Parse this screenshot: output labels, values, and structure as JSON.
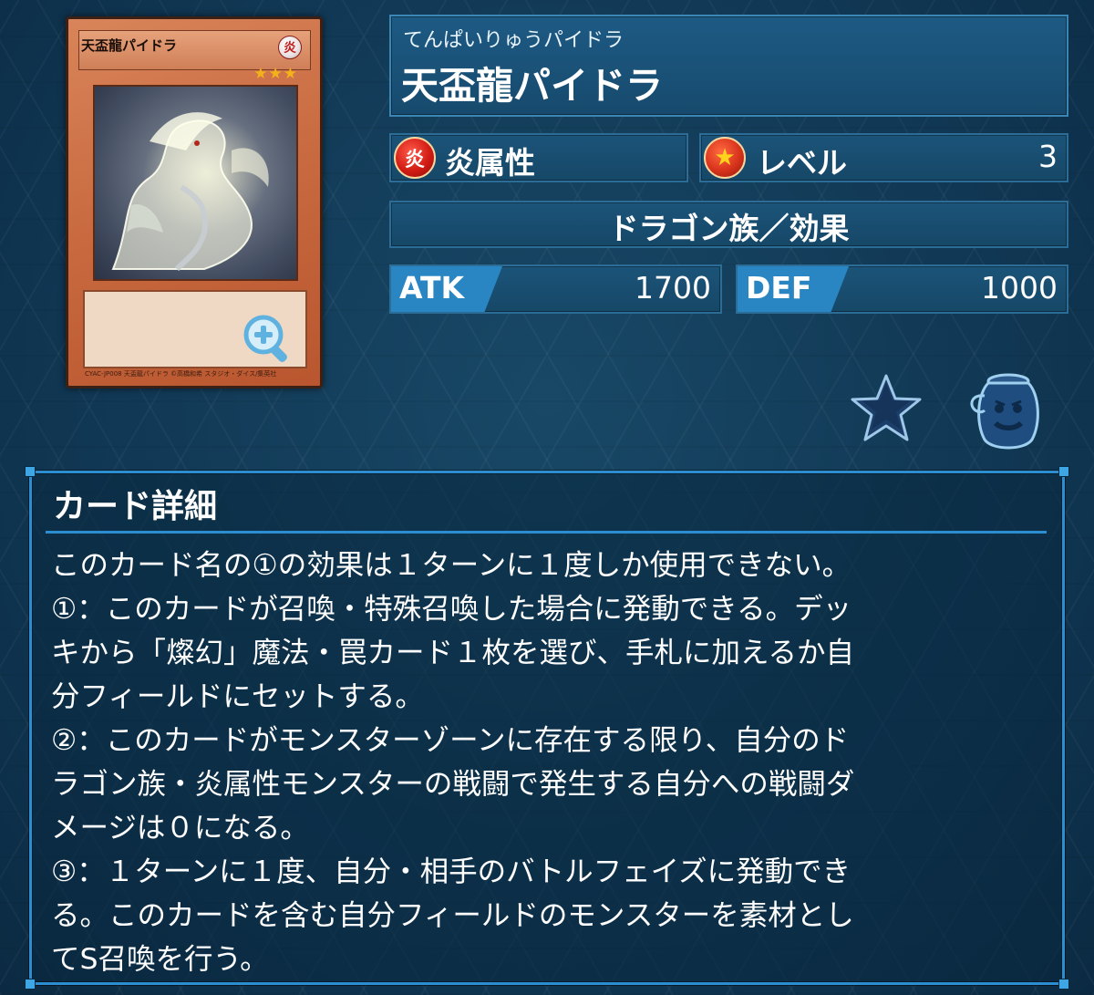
{
  "card_image": {
    "name_text": "天盃龍パイドラ",
    "attribute_glyph": "炎",
    "stars": "★★★",
    "footer_text": "CYAC-JP008 天盃龍パイドラ ©高橋和希 スタジオ・ダイス/集英社"
  },
  "card": {
    "ruby": "てんぱいりゅうパイドラ",
    "name": "天盃龍パイドラ",
    "attribute": {
      "icon": "fire-attribute-icon",
      "glyph": "炎",
      "label": "炎属性",
      "color": "#d21c14"
    },
    "level": {
      "icon": "level-star-icon",
      "label": "レベル",
      "value": "3"
    },
    "type_line": "ドラゴン族／効果",
    "atk": {
      "label": "ATK",
      "value": "1700"
    },
    "def": {
      "label": "DEF",
      "value": "1000"
    }
  },
  "actions": {
    "favorite_icon": "star-icon",
    "pot_icon": "pot-of-greed-icon",
    "zoom_icon": "zoom-in-icon"
  },
  "detail": {
    "title": "カード詳細",
    "lines": [
      "このカード名の①の効果は１ターンに１度しか使用できない。",
      "①：このカードが召喚・特殊召喚した場合に発動できる。デッ",
      "キから「燦幻」魔法・罠カード１枚を選び、手札に加えるか自",
      "分フィールドにセットする。",
      "②：このカードがモンスターゾーンに存在する限り、自分のド",
      "ラゴン族・炎属性モンスターの戦闘で発生する自分への戦闘ダ",
      "メージは０になる。",
      "③：１ターンに１度、自分・相手のバトルフェイズに発動でき",
      "る。このカードを含む自分フィールドのモンスターを素材とし",
      "てS召喚を行う。"
    ]
  },
  "colors": {
    "background": "#123955",
    "panel": "#1b5479",
    "accent_blue": "#2c8ed1",
    "stat_tag": "#2a86c3"
  }
}
